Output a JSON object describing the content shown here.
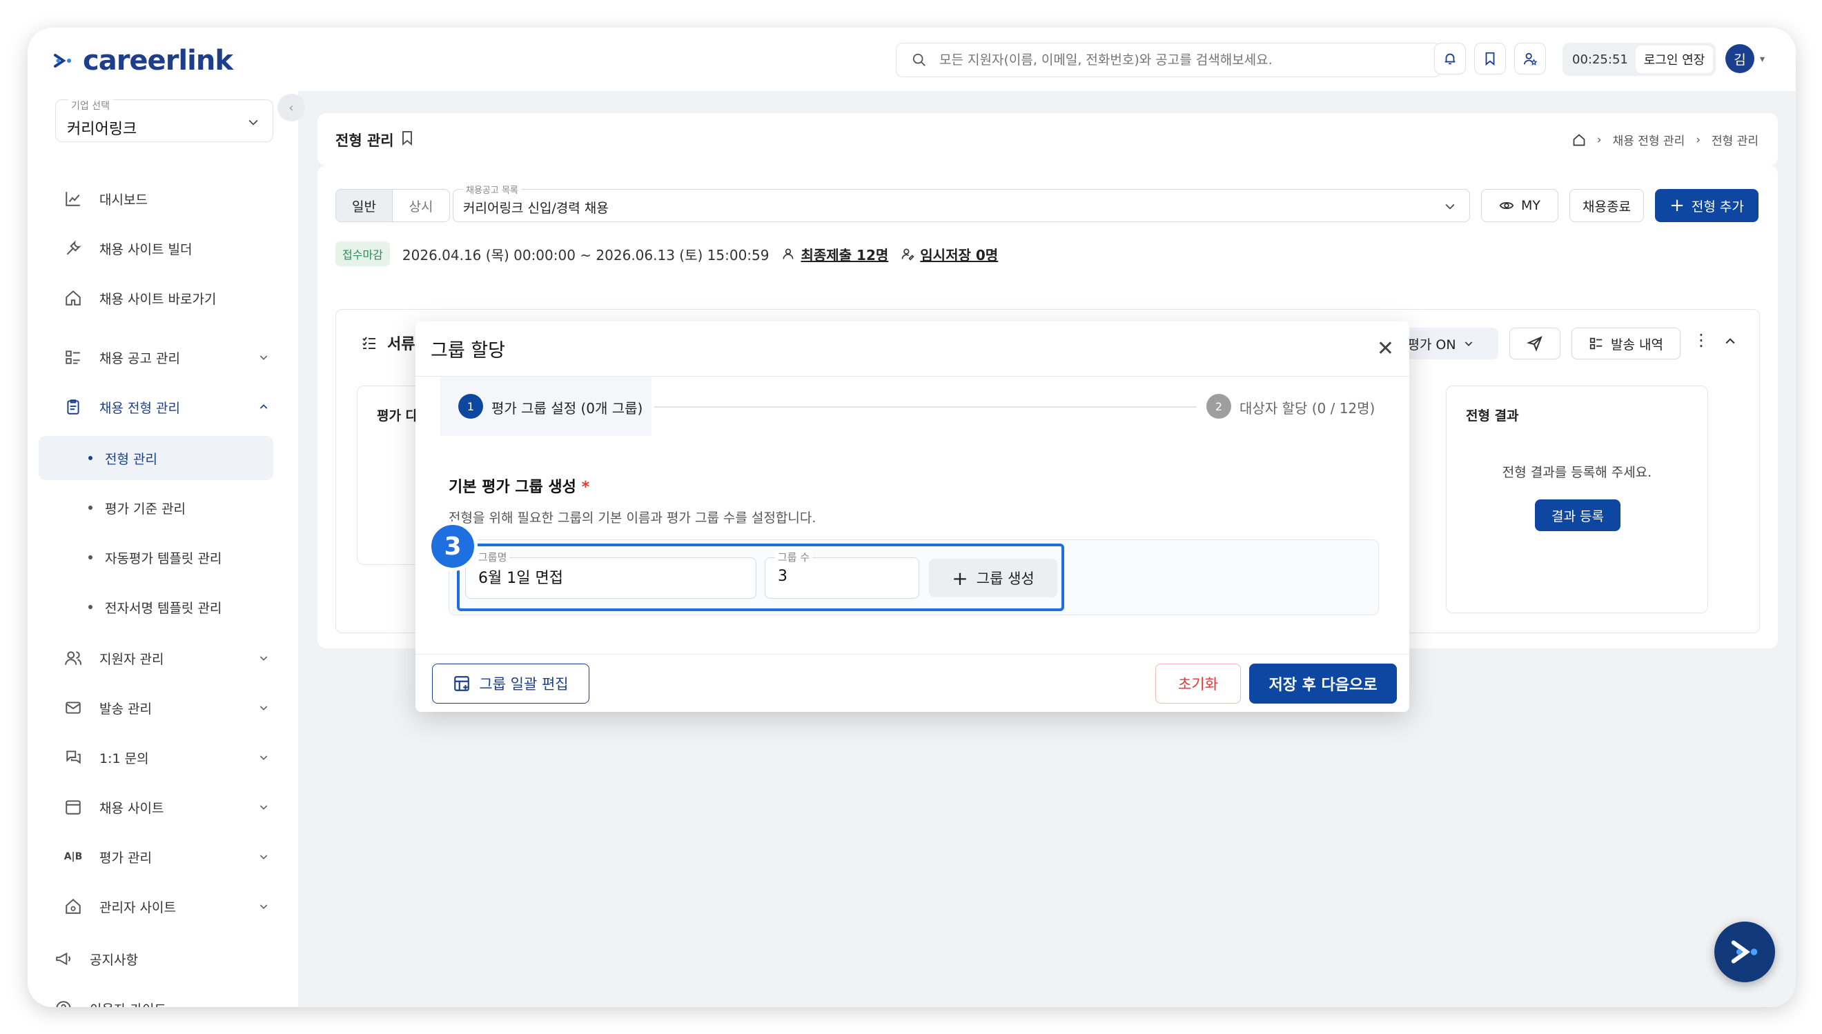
{
  "brand": {
    "name": "careerlink",
    "color": "#1a3f8f"
  },
  "header": {
    "search_placeholder": "모든 지원자(이름, 이메일, 전화번호)와 공고를 검색해보세요.",
    "timer": "00:25:51",
    "extend_label": "로그인 연장",
    "avatar_initial": "김"
  },
  "sidebar": {
    "company_label": "기업 선택",
    "company_value": "커리어링크",
    "items": [
      {
        "label": "대시보드",
        "icon": "chart-icon"
      },
      {
        "label": "채용 사이트 빌더",
        "icon": "tools-icon"
      },
      {
        "label": "채용 사이트 바로가기",
        "icon": "home-icon"
      },
      {
        "label": "채용 공고 관리",
        "icon": "list-icon"
      },
      {
        "label": "채용 전형 관리",
        "icon": "clipboard-icon"
      },
      {
        "label": "지원자 관리",
        "icon": "users-icon"
      },
      {
        "label": "발송 관리",
        "icon": "mail-icon"
      },
      {
        "label": "1:1 문의",
        "icon": "chat-icon"
      },
      {
        "label": "채용 사이트",
        "icon": "calendar-icon"
      },
      {
        "label": "평가 관리",
        "icon": "ab-icon"
      },
      {
        "label": "관리자 사이트",
        "icon": "admin-home-icon"
      },
      {
        "label": "공지사항",
        "icon": "megaphone-icon"
      },
      {
        "label": "이용자 가이드",
        "icon": "help-icon"
      }
    ],
    "subitems": [
      "전형 관리",
      "평가 기준 관리",
      "자동평가 템플릿 관리",
      "전자서명 템플릿 관리"
    ]
  },
  "page": {
    "title": "전형 관리",
    "breadcrumb": [
      "채용 전형 관리",
      "전형 관리"
    ],
    "seg": [
      "일반",
      "상시"
    ],
    "posting_label": "채용공고 목록",
    "posting_value": "커리어링크 신입/경력 채용",
    "my_label": "MY",
    "end_label": "채용종료",
    "add_label": "전형 추가",
    "status_badge": "접수마감",
    "period": "2026.04.16 (목) 00:00:00 ~ 2026.06.13 (토) 15:00:59",
    "final_submit": "최종제출 12명",
    "temp_save": "임시저장 0명",
    "stage_title": "서류전형",
    "auto_eval": "자동평가 ON",
    "history_label": "발송 내역",
    "left_card_title": "평가 다",
    "result_title": "전형 결과",
    "result_msg": "전형 결과를 등록해 주세요.",
    "result_btn": "결과 등록"
  },
  "modal": {
    "title": "그룹 할당",
    "step1_num": "1",
    "step1_label": "평가 그룹 설정 (0개 그룹)",
    "step2_num": "2",
    "step2_label": "대상자 할당 (0 / 12명)",
    "section_title": "기본 평가 그룹 생성",
    "required_mark": "*",
    "section_desc": "전형을 위해 필요한 그룹의 기본 이름과 평가 그룹 수를 설정합니다.",
    "name_label": "그룹명",
    "name_value": "6월 1일 면접",
    "count_label": "그룹 수",
    "count_value": "3",
    "create_label": "그룹 생성",
    "highlight_num": "3",
    "bulk_edit_label": "그룹 일괄 편집",
    "reset_label": "초기화",
    "save_next_label": "저장 후 다음으로"
  }
}
